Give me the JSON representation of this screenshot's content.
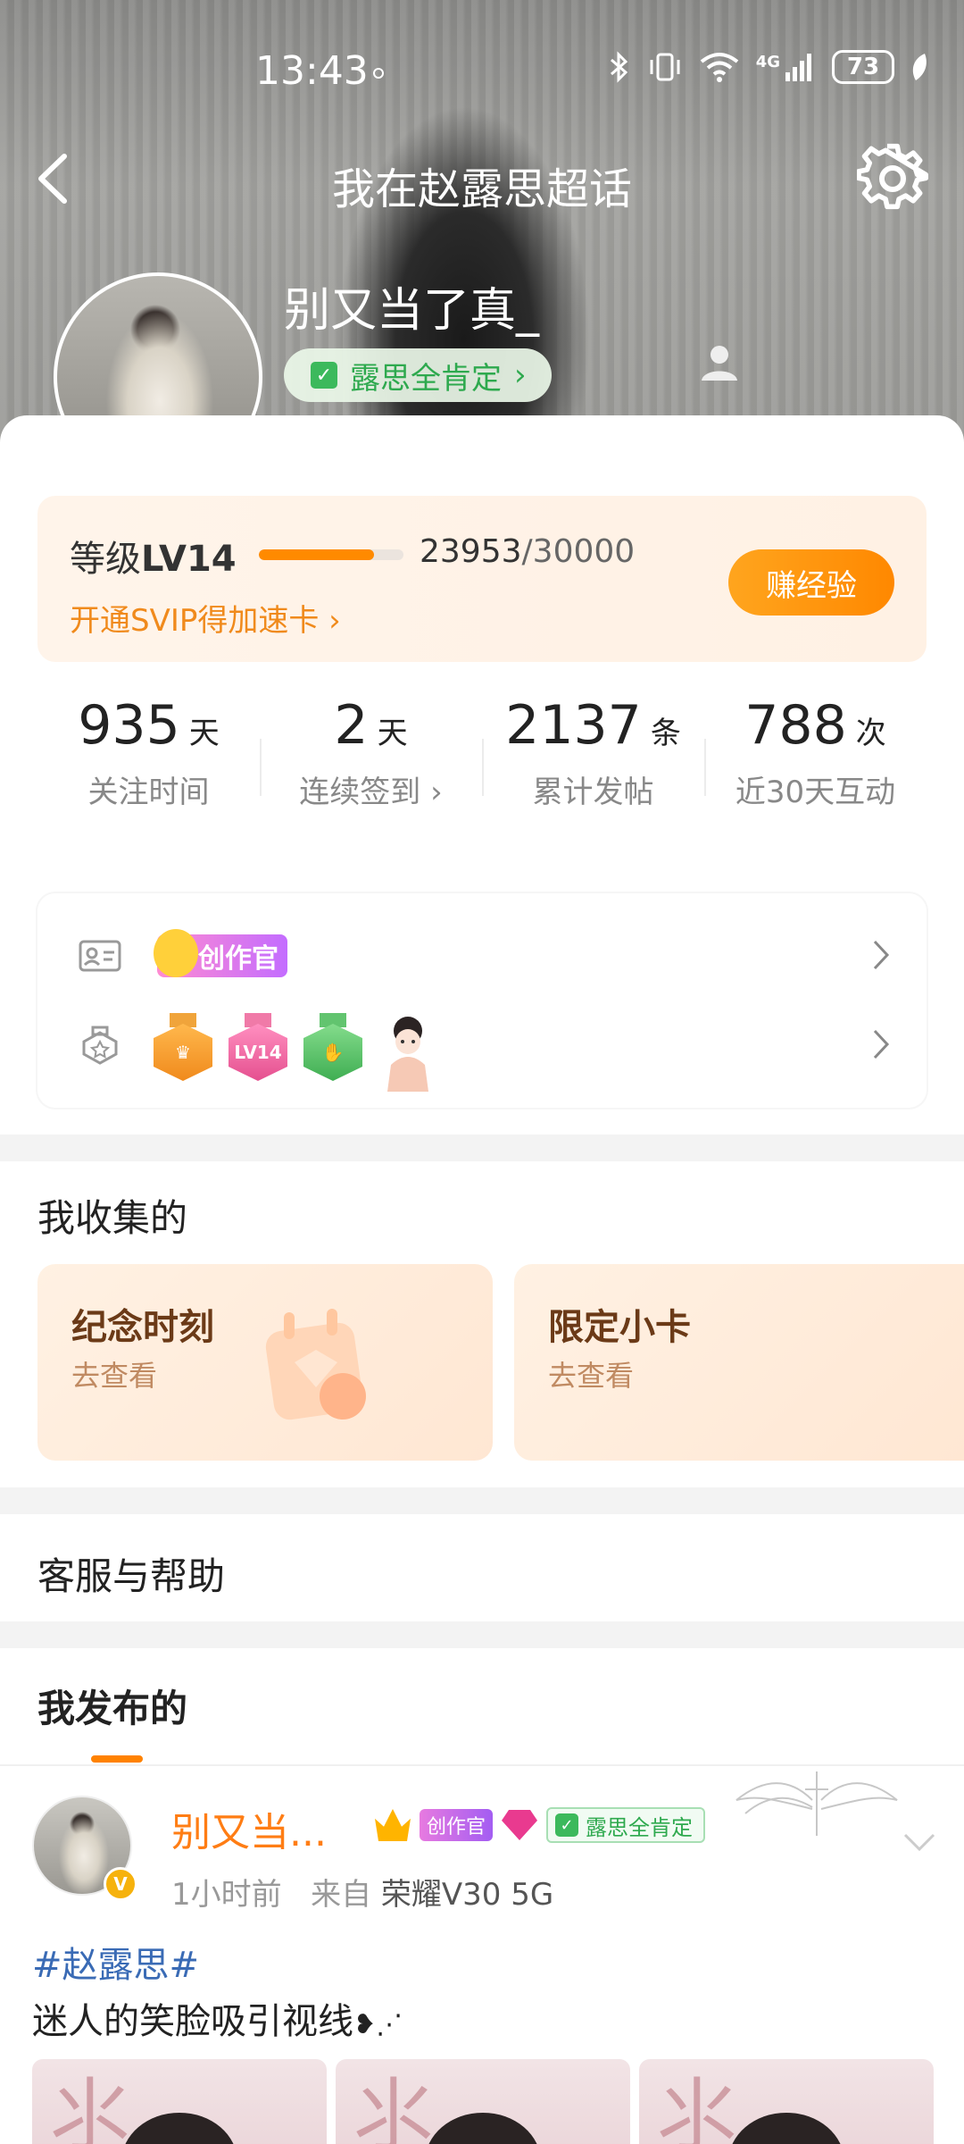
{
  "status_bar": {
    "time": "13:43",
    "network": "4G",
    "battery": "73"
  },
  "nav": {
    "title": "我在赵露思超话"
  },
  "profile": {
    "username": "别又当了真_",
    "fan_tag": "露思全肯定",
    "verified_badge": "V"
  },
  "level": {
    "label_prefix": "等级",
    "level": "LV14",
    "exp_current": "23953",
    "exp_total": "/30000",
    "progress": 0.798,
    "svip_link": "开通SVIP得加速卡 ›",
    "earn_button": "赚经验"
  },
  "stats": [
    {
      "num": "935",
      "unit": "天",
      "label": "关注时间"
    },
    {
      "num": "2",
      "unit": "天",
      "label": "连续签到 ›"
    },
    {
      "num": "2137",
      "unit": "条",
      "label": "累计发帖"
    },
    {
      "num": "788",
      "unit": "次",
      "label": "近30天互动"
    }
  ],
  "badges": {
    "creator_tag": "创作官",
    "medal_lv_text": "LV14"
  },
  "collections": {
    "title": "我收集的",
    "cards": [
      {
        "title": "纪念时刻",
        "sub": "去查看"
      },
      {
        "title": "限定小卡",
        "sub": "去查看"
      }
    ]
  },
  "service": {
    "title": "客服与帮助"
  },
  "posts": {
    "title": "我发布的",
    "author": "别又当...",
    "creator_tag": "创作官",
    "fan_tag": "露思全肯定",
    "time": "1小时前",
    "from_prefix": "来自",
    "device": "荣耀V30 5G",
    "hashtag": "#赵露思#",
    "text": "迷人的笑脸吸引视线"
  },
  "colors": {
    "accent": "#ff8800",
    "fan_green": "#2ea94e",
    "link_blue": "#3a6bb5",
    "verified_gold": "#f6b20d"
  }
}
